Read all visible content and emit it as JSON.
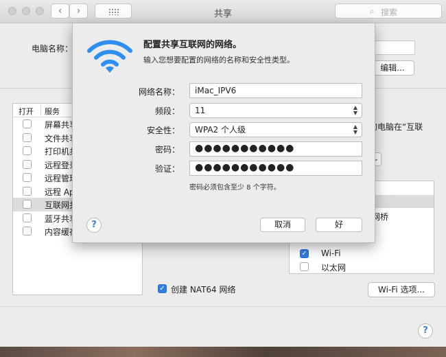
{
  "window": {
    "title": "共享",
    "search_placeholder": "搜索",
    "search_icon": "magnifier-icon",
    "nav_back_glyph": "‹",
    "nav_forward_glyph": "›"
  },
  "computer": {
    "label": "电脑名称：",
    "edit_button": "编辑..."
  },
  "services": {
    "header_open": "打开",
    "header_service": "服务",
    "items": [
      {
        "label": "屏幕共享",
        "checked": false
      },
      {
        "label": "文件共享",
        "checked": false
      },
      {
        "label": "打印机共享",
        "checked": false
      },
      {
        "label": "远程登录",
        "checked": false
      },
      {
        "label": "远程管理",
        "checked": false
      },
      {
        "label": "远程 Apple 事件",
        "checked": false
      },
      {
        "label": "互联网共享",
        "checked": false,
        "selected": true
      },
      {
        "label": "蓝牙共享",
        "checked": false
      },
      {
        "label": "内容缓存",
        "checked": false
      }
    ]
  },
  "right_panel": {
    "text_line1": "的电脑在“互联",
    "text_line2": "",
    "bridge_text": "网桥",
    "ports": [
      {
        "label": "Wi-Fi",
        "checked": true
      },
      {
        "label": "以太网",
        "checked": false
      }
    ],
    "nat64_label": "创建 NAT64 网络",
    "nat64_checked": true,
    "wifi_options_button": "Wi-Fi 选项..."
  },
  "dialog": {
    "title": "配置共享互联网的网络。",
    "subtitle": "输入您想要配置的网络的名称和安全性类型。",
    "fields": {
      "network_name_label": "网络名称：",
      "network_name_value": "iMac_IPV6",
      "channel_label": "频段：",
      "channel_value": "11",
      "security_label": "安全性：",
      "security_value": "WPA2 个人级",
      "password_label": "密码：",
      "password_value": "●●●●●●●●●●●",
      "verify_label": "验证：",
      "verify_value": "●●●●●●●●●●●"
    },
    "hint": "密码必须包含至少 8 个字符。",
    "cancel_button": "取消",
    "ok_button": "好",
    "help_glyph": "?"
  },
  "colors": {
    "accent": "#2f7de1",
    "wifi_icon": "#2e8ff0"
  }
}
